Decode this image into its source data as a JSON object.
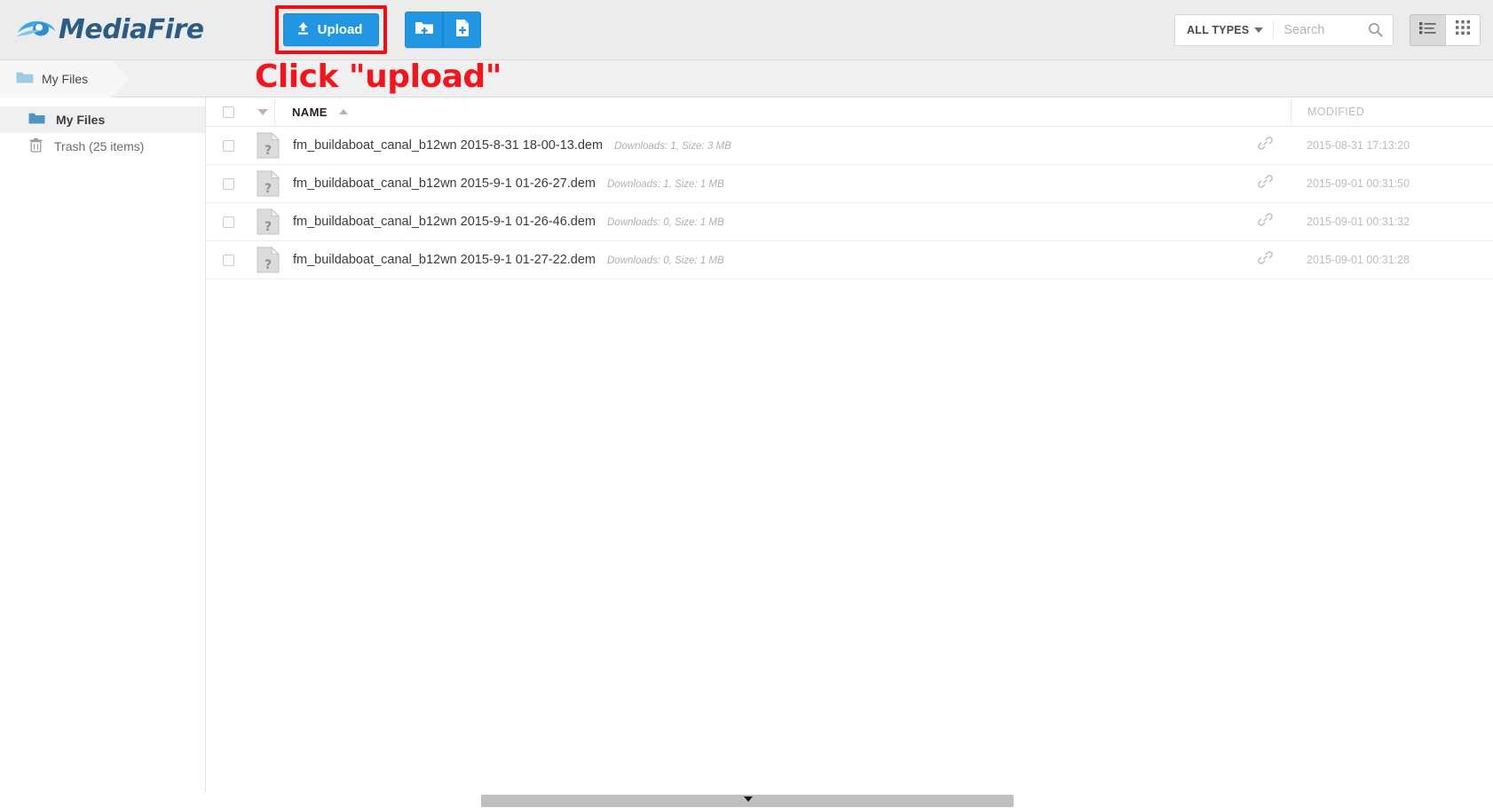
{
  "brand": {
    "name": "MediaFire",
    "logo_icon": "mediafire-flame-logo",
    "color": "#2b5c86"
  },
  "toolbar": {
    "upload_label": "Upload",
    "upload_icon": "upload-arrow-icon",
    "highlight_color": "#f40d14",
    "new_folder_icon": "new-folder-icon",
    "new_file_icon": "new-file-icon",
    "button_color": "#2196e3"
  },
  "search": {
    "type_filter_label": "ALL TYPES",
    "type_filter_icon": "chevron-down-icon",
    "placeholder": "Search",
    "value": "",
    "search_icon": "search-icon"
  },
  "view_toggle": {
    "list_icon": "list-view-icon",
    "grid_icon": "grid-view-icon",
    "active": "list"
  },
  "breadcrumb": {
    "folder_icon": "folder-icon",
    "label": "My Files"
  },
  "annotation": {
    "text": "Click \"upload\"",
    "color": "#f4141b"
  },
  "sidebar": {
    "items": [
      {
        "label": "My Files",
        "icon": "folder-icon",
        "active": true
      },
      {
        "label": "Trash (25 items)",
        "icon": "trash-icon",
        "active": false
      }
    ]
  },
  "table": {
    "select_all_checked": false,
    "sort_menu_icon": "triangle-down-icon",
    "columns": {
      "name": "NAME",
      "modified": "MODIFIED"
    },
    "sort_indicator_icon": "triangle-up-icon",
    "rows": [
      {
        "checked": false,
        "file_icon": "unknown-file-icon",
        "name": "fm_buildaboat_canal_b12wn 2015-8-31 18-00-13.dem",
        "meta": "Downloads: 1, Size: 3 MB",
        "link_icon": "link-icon",
        "modified": "2015-08-31 17:13:20"
      },
      {
        "checked": false,
        "file_icon": "unknown-file-icon",
        "name": "fm_buildaboat_canal_b12wn 2015-9-1 01-26-27.dem",
        "meta": "Downloads: 1, Size: 1 MB",
        "link_icon": "link-icon",
        "modified": "2015-09-01 00:31:50"
      },
      {
        "checked": false,
        "file_icon": "unknown-file-icon",
        "name": "fm_buildaboat_canal_b12wn 2015-9-1 01-26-46.dem",
        "meta": "Downloads: 0, Size: 1 MB",
        "link_icon": "link-icon",
        "modified": "2015-09-01 00:31:32"
      },
      {
        "checked": false,
        "file_icon": "unknown-file-icon",
        "name": "fm_buildaboat_canal_b12wn 2015-9-1 01-27-22.dem",
        "meta": "Downloads: 0, Size: 1 MB",
        "link_icon": "link-icon",
        "modified": "2015-09-01 00:31:28"
      }
    ]
  },
  "scrollbar": {
    "orientation": "horizontal",
    "arrow_icon": "triangle-down-icon"
  }
}
